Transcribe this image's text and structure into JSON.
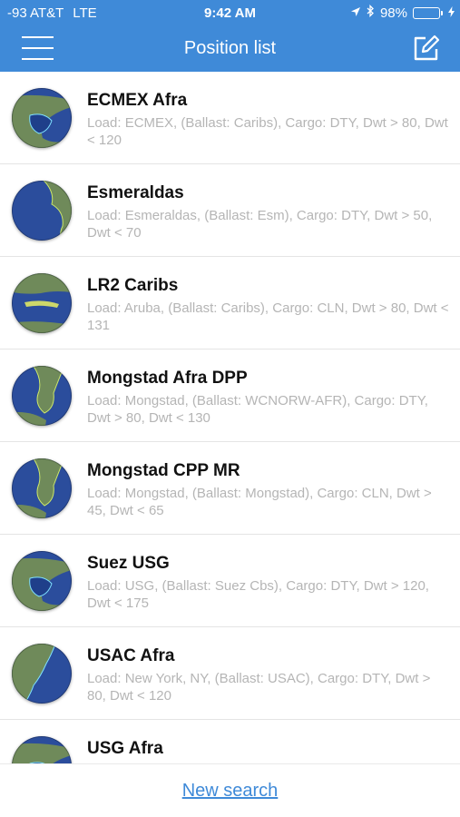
{
  "status_bar": {
    "carrier": "-93 AT&T",
    "network": "LTE",
    "time": "9:42 AM",
    "battery": "98%",
    "battery_level": 0.98
  },
  "nav": {
    "title": "Position list",
    "menu_icon": "hamburger-menu-icon",
    "edit_icon": "compose-icon"
  },
  "colors": {
    "accent": "#3f8ad8",
    "subtitle": "#b5b5b5"
  },
  "items": [
    {
      "title": "ECMEX Afra",
      "subtitle": "Load: ECMEX, (Ballast: Caribs), Cargo: DTY, Dwt > 80, Dwt < 120",
      "region": "gulf"
    },
    {
      "title": "Esmeraldas",
      "subtitle": "Load: Esmeraldas, (Ballast: Esm), Cargo: DTY, Dwt > 50, Dwt < 70",
      "region": "pacific"
    },
    {
      "title": "LR2 Caribs",
      "subtitle": "Load: Aruba, (Ballast: Caribs), Cargo: CLN, Dwt > 80, Dwt < 131",
      "region": "caribs"
    },
    {
      "title": "Mongstad Afra DPP",
      "subtitle": "Load: Mongstad, (Ballast: WCNORW-AFR), Cargo: DTY, Dwt > 80, Dwt < 130",
      "region": "norway"
    },
    {
      "title": "Mongstad CPP MR",
      "subtitle": "Load: Mongstad, (Ballast: Mongstad), Cargo: CLN, Dwt > 45, Dwt < 65",
      "region": "norway"
    },
    {
      "title": "Suez USG",
      "subtitle": "Load: USG, (Ballast: Suez Cbs), Cargo: DTY, Dwt > 120, Dwt < 175",
      "region": "gulf"
    },
    {
      "title": "USAC Afra",
      "subtitle": "Load: New York, NY, (Ballast: USAC), Cargo: DTY, Dwt > 80, Dwt < 120",
      "region": "usac"
    },
    {
      "title": "USG Afra",
      "subtitle": "",
      "region": "gulf"
    }
  ],
  "bottom": {
    "new_search_label": "New search"
  }
}
